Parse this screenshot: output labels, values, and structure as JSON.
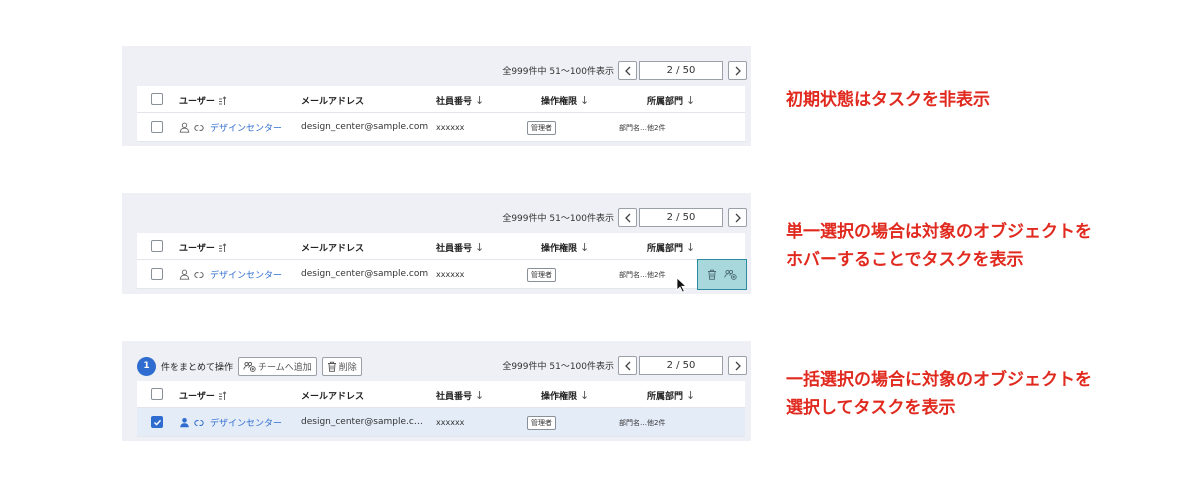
{
  "colors": {
    "accent": "#2f6cd0",
    "annotation": "#e12a1f",
    "hover_task_bg": "#a8d7dc",
    "selected_row_bg": "#e4ecf8"
  },
  "pagination": {
    "summary": "全999件中 51〜100件表示",
    "page": "2 / 50",
    "prev_icon": "chevron-left-icon",
    "next_icon": "chevron-right-icon"
  },
  "columns": {
    "user": "ユーザー",
    "email": "メールアドレス",
    "employee_no": "社員番号",
    "permission": "操作権限",
    "department": "所属部門"
  },
  "row": {
    "user_name": "デザインセンター",
    "email": "design_center@sample.com",
    "email_truncated": "design_center@sample.c…",
    "employee_no": "xxxxxx",
    "permission": "管理者",
    "department": "部門名…他2件"
  },
  "bulk": {
    "selected_count": "1",
    "label": "件をまとめて操作",
    "add_team": "チームへ追加",
    "delete": "削除"
  },
  "notes": {
    "initial": "初期状態はタスクを非表示",
    "single_line1": "単一選択の場合は対象のオブジェクトを",
    "single_line2": "ホバーすることでタスクを表示",
    "bulk_line1": "一括選択の場合に対象のオブジェクトを",
    "bulk_line2": "選択してタスクを表示"
  }
}
